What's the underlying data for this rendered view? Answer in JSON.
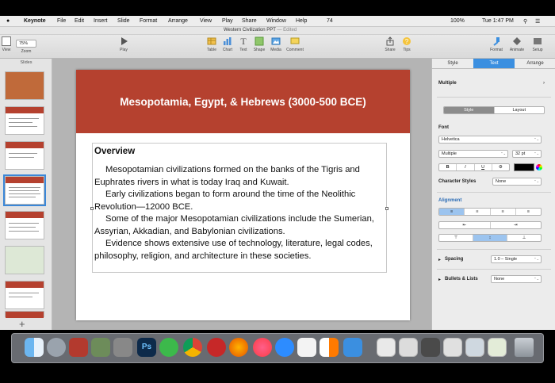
{
  "menubar": {
    "apple": "",
    "items": [
      "Keynote",
      "File",
      "Edit",
      "Insert",
      "Slide",
      "Format",
      "Arrange",
      "View",
      "Play",
      "Share",
      "Window",
      "Help"
    ],
    "status": {
      "battery_left": "74",
      "battery": "100%",
      "clock": "Tue 1:47 PM"
    }
  },
  "window": {
    "title": "Western Civilization PPT",
    "edited": "— Edited"
  },
  "toolbar": {
    "view": "View",
    "zoom_label": "Zoom",
    "zoom_value": "75%",
    "play": "Play",
    "table": "Table",
    "chart": "Chart",
    "text": "Text",
    "shape": "Shape",
    "media": "Media",
    "comment": "Comment",
    "share": "Share",
    "tips": "Tips",
    "format": "Format",
    "animate": "Animate",
    "setup": "Setup"
  },
  "navigator": {
    "header": "Slides",
    "add": "+"
  },
  "slide": {
    "title": "Mesopotamia, Egypt, & Hebrews (3000-500 BCE)",
    "heading": "Overview",
    "paragraphs": [
      "Mesopotamian civilizations formed on the banks of the Tigris and Euphrates rivers in what is today Iraq and Kuwait.",
      "Early civilizations began to form around the time of the Neolithic Revolution—12000 BCE.",
      "Some of the major Mesopotamian civilizations include the Sumerian, Assyrian, Akkadian, and Babylonian civilizations.",
      "Evidence shows extensive use of technology, literature, legal codes, philosophy, religion, and architecture in these societies."
    ]
  },
  "inspector": {
    "tabs": [
      "Style",
      "Text",
      "Arrange"
    ],
    "paragraph_style": "Multiple",
    "style_tabs": [
      "Style",
      "Layout"
    ],
    "font_label": "Font",
    "font_family": "Helvetica",
    "font_typeface": "Multiple",
    "font_size": "32 pt",
    "bold": "B",
    "italic": "I",
    "underline": "U",
    "gear": "⚙",
    "character_styles_label": "Character Styles",
    "character_styles_value": "None",
    "alignment_label": "Alignment",
    "spacing_label": "Spacing",
    "spacing_value": "1.0 – Single",
    "bullets_label": "Bullets & Lists",
    "bullets_value": "None"
  }
}
